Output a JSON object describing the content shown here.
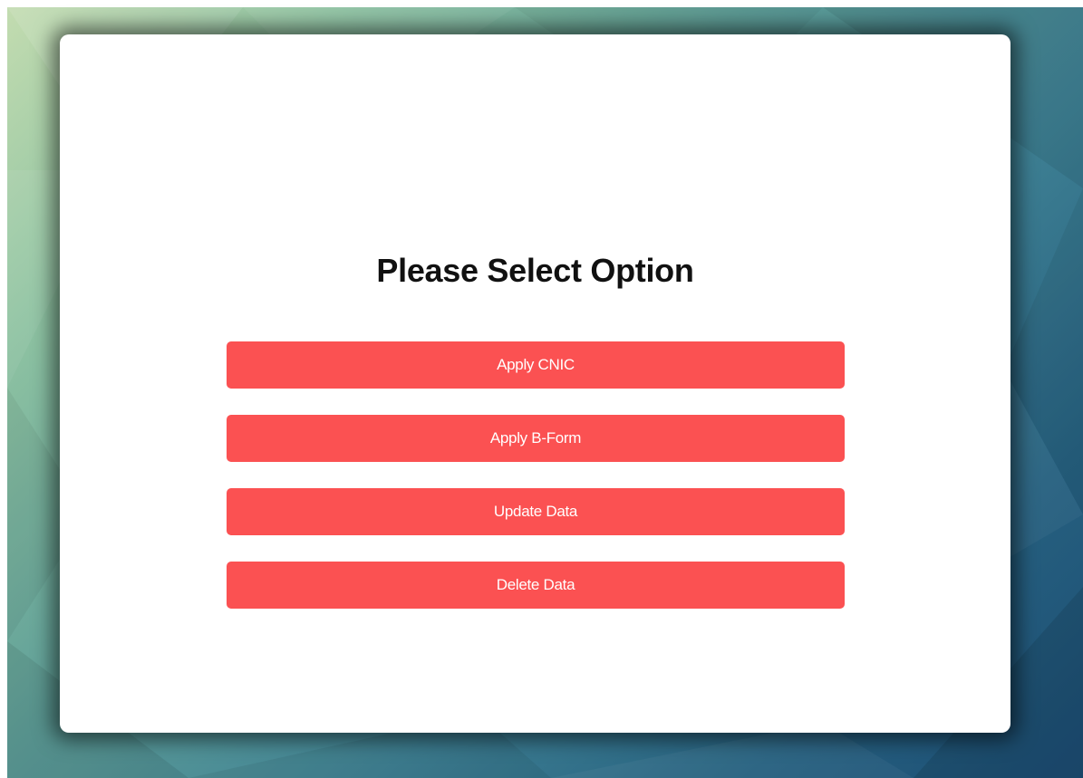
{
  "dialog": {
    "title": "Please Select Option",
    "options": [
      {
        "label": "Apply CNIC"
      },
      {
        "label": "Apply B-Form"
      },
      {
        "label": "Update Data"
      },
      {
        "label": "Delete Data"
      }
    ]
  },
  "colors": {
    "button": "#fb5152",
    "button_text": "#ffffff",
    "card": "#ffffff",
    "title_text": "#111111"
  }
}
